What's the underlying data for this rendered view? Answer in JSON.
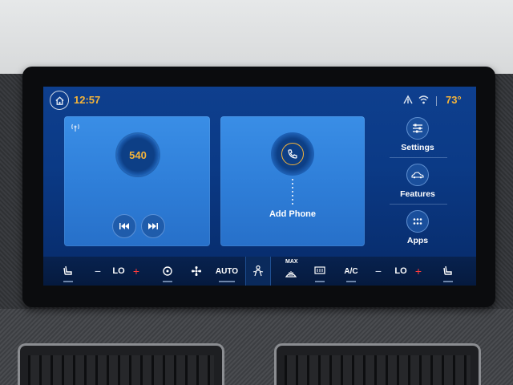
{
  "status": {
    "time": "12:57",
    "outside_temp": "73°"
  },
  "radio": {
    "frequency": "540"
  },
  "phone": {
    "add_label": "Add Phone"
  },
  "shortcuts": {
    "settings": "Settings",
    "features": "Features",
    "apps": "Apps"
  },
  "climate": {
    "left_temp": "LO",
    "right_temp": "LO",
    "minus": "−",
    "plus": "+",
    "auto": "AUTO",
    "max": "MAX",
    "ac": "A/C"
  },
  "colors": {
    "accent": "#f4b43a",
    "plus_red": "#ff3b3b",
    "card_blue": "#2f7fd9",
    "screen_bg": "#0b3a86"
  }
}
